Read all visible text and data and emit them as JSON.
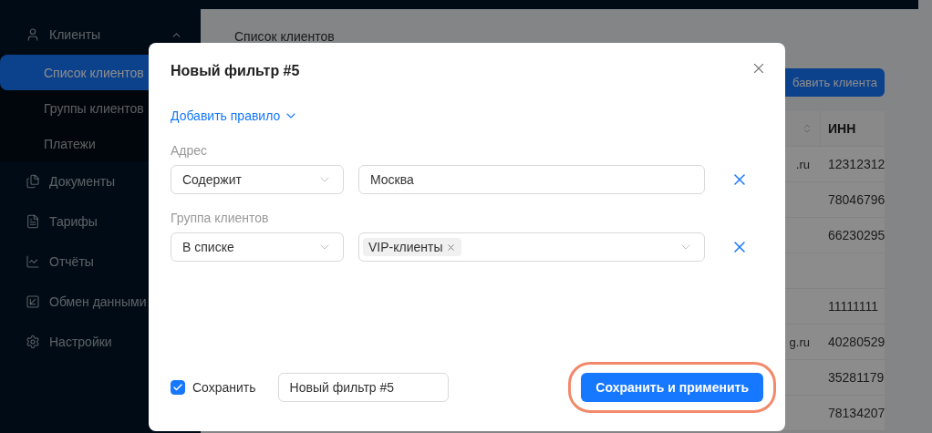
{
  "sidebar": {
    "items": [
      {
        "label": "Клиенты",
        "selected": false,
        "expanded": true,
        "children": [
          {
            "label": "Список клиентов",
            "selected": true
          },
          {
            "label": "Группы клиентов",
            "selected": false
          },
          {
            "label": "Платежи",
            "selected": false
          }
        ]
      },
      {
        "label": "Документы",
        "selected": false
      },
      {
        "label": "Тарифы",
        "selected": false
      },
      {
        "label": "Отчёты",
        "selected": false
      },
      {
        "label": "Обмен данными",
        "selected": false
      },
      {
        "label": "Настройки",
        "selected": false
      }
    ]
  },
  "main": {
    "breadcrumb": "Список клиентов",
    "add_button": "бавить клиента",
    "table": {
      "header": {
        "column_2": "ИНН"
      },
      "rows": [
        {
          "column_1": ".ru",
          "column_2": "12312312"
        },
        {
          "column_2": "78046796"
        },
        {
          "column_2": "66230295"
        },
        {},
        {
          "column_2": "11111111"
        },
        {
          "column_1": "g.ru",
          "column_2": "40280529"
        },
        {
          "column_2": "35281179"
        },
        {
          "column_2": "78134207"
        }
      ]
    }
  },
  "modal": {
    "title": "Новый фильтр #5",
    "add_rule": "Добавить правило",
    "rules": [
      {
        "label": "Адрес",
        "kind": "text",
        "operator": "Содержит",
        "value": "Москва"
      },
      {
        "label": "Группа клиентов",
        "kind": "tags",
        "operator": "В списке",
        "tags": [
          "VIP-клиенты"
        ]
      }
    ],
    "footer": {
      "save_checkbox": {
        "label": "Сохранить",
        "checked": true
      },
      "name_value": "Новый фильтр #5",
      "apply_button": {
        "label": "Сохранить и применить",
        "highlighted": true
      }
    }
  }
}
